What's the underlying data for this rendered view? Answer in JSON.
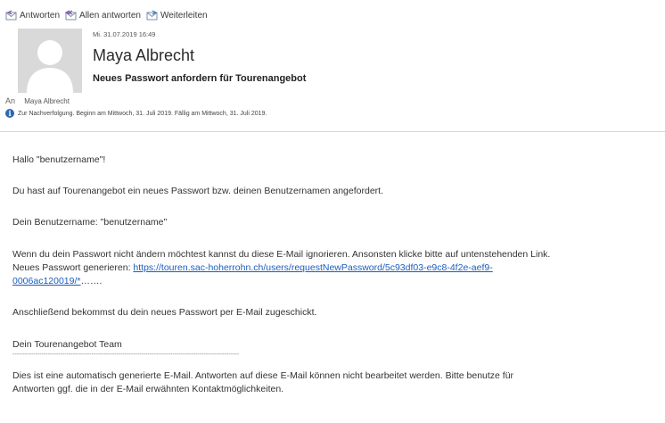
{
  "toolbar": {
    "reply_label": "Antworten",
    "reply_all_label": "Allen antworten",
    "forward_label": "Weiterleiten"
  },
  "header": {
    "date": "Mi. 31.07.2019 16:49",
    "sender": "Maya Albrecht",
    "subject": "Neues Passwort anfordern für Tourenangebot",
    "to_label": "An",
    "to_name": "Maya Albrecht",
    "followup": "Zur Nachverfolgung. Beginn am Mittwoch, 31. Juli 2019. Fällig am Mittwoch, 31. Juli 2019."
  },
  "body": {
    "greeting": "Hallo \"benutzername\"!",
    "intro": "Du hast auf Tourenangebot ein neues Passwort bzw. deinen Benutzernamen angefordert.",
    "username_line": "Dein Benutzername: \"benutzername\"",
    "ignore_line": "Wenn du dein Passwort nicht ändern möchtest kannst du diese E-Mail ignorieren. Ansonsten klicke bitte auf untenstehenden Link.",
    "generate_label": "Neues Passwort generieren: ",
    "link_part1": "https://touren.sac-hoherrohn.ch/users/requestNewPassword/5c93df03-e9c8-4f2e-aef9-",
    "link_part2": "0006ac120019/*",
    "link_suffix": "…….",
    "after_line": "Anschließend bekommst du dein neues Passwort per E-Mail zugeschickt.",
    "signature": "Dein Tourenangebot Team",
    "separator": "-------------------------------------------------------------------------------------------------------------",
    "auto1": "Dies ist eine automatisch generierte E-Mail. Antworten auf diese E-Mail können nicht bearbeitet werden. Bitte benutze für",
    "auto2": "Antworten ggf. die in der E-Mail erwähnten Kontaktmöglichkeiten."
  },
  "icons": {
    "reply": "reply-icon",
    "reply_all": "reply-all-icon",
    "forward": "forward-icon",
    "avatar": "person-silhouette-icon",
    "info": "info-icon"
  },
  "colors": {
    "link": "#1a5dbf",
    "info": "#2b68b3",
    "avatar_bg": "#d9d9d9"
  }
}
